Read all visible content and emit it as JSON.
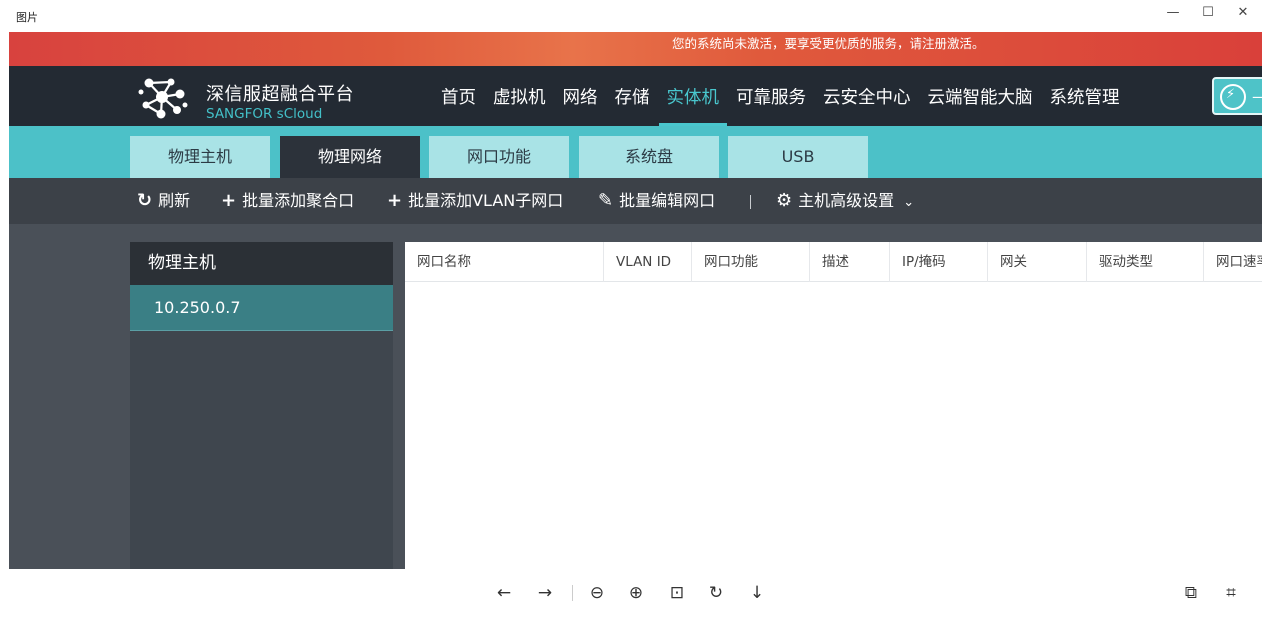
{
  "window": {
    "title": "图片",
    "minimize_glyph": "—",
    "maximize_glyph": "☐",
    "close_glyph": "✕"
  },
  "banner": {
    "message": "您的系统尚未激活，要享受更优质的服务，请注册激活。"
  },
  "brand": {
    "name_cn": "深信服超融合平台",
    "name_en": "SANGFOR sCloud"
  },
  "nav": {
    "items": [
      {
        "label": "首页"
      },
      {
        "label": "虚拟机"
      },
      {
        "label": "网络"
      },
      {
        "label": "存储"
      },
      {
        "label": "实体机",
        "active": true
      },
      {
        "label": "可靠服务"
      },
      {
        "label": "云安全中心"
      },
      {
        "label": "云端智能大脑"
      },
      {
        "label": "系统管理"
      }
    ],
    "quick_button_text": "—",
    "accent_color": "#49c6cd"
  },
  "tabs": [
    {
      "label": "物理主机"
    },
    {
      "label": "物理网络",
      "active": true
    },
    {
      "label": "网口功能"
    },
    {
      "label": "系统盘"
    },
    {
      "label": "USB"
    }
  ],
  "toolbar": {
    "refresh": {
      "icon": "refresh-icon",
      "glyph": "↻",
      "label": "刷新"
    },
    "add_bond": {
      "icon": "plus-icon",
      "glyph": "+",
      "label": "批量添加聚合口"
    },
    "add_vlan": {
      "icon": "plus-icon",
      "glyph": "+",
      "label": "批量添加VLAN子网口"
    },
    "edit_ports": {
      "icon": "pencil-icon",
      "glyph": "✎",
      "label": "批量编辑网口"
    },
    "separator": "|",
    "advanced": {
      "icon": "gear-icon",
      "glyph": "⚙",
      "label": "主机高级设置",
      "chevron": "⌄"
    }
  },
  "sidebar": {
    "header": "物理主机",
    "items": [
      {
        "label": "10.250.0.7",
        "selected": true
      }
    ]
  },
  "table": {
    "columns": [
      "网口名称",
      "VLAN ID",
      "网口功能",
      "描述",
      "IP/掩码",
      "网关",
      "驱动类型",
      "网口速率"
    ],
    "rows": []
  },
  "viewer": {
    "buttons": [
      {
        "name": "back-arrow-icon",
        "glyph": "←"
      },
      {
        "name": "forward-arrow-icon",
        "glyph": "→"
      },
      {
        "name": "zoom-out-icon",
        "glyph": "⊖"
      },
      {
        "name": "zoom-in-icon",
        "glyph": "⊕"
      },
      {
        "name": "fit-screen-icon",
        "glyph": "⊡"
      },
      {
        "name": "rotate-icon",
        "glyph": "↻"
      },
      {
        "name": "download-icon",
        "glyph": "↓"
      },
      {
        "name": "image-translate-icon",
        "glyph": "⧉"
      },
      {
        "name": "text-scan-icon",
        "glyph": "⌗"
      }
    ]
  }
}
